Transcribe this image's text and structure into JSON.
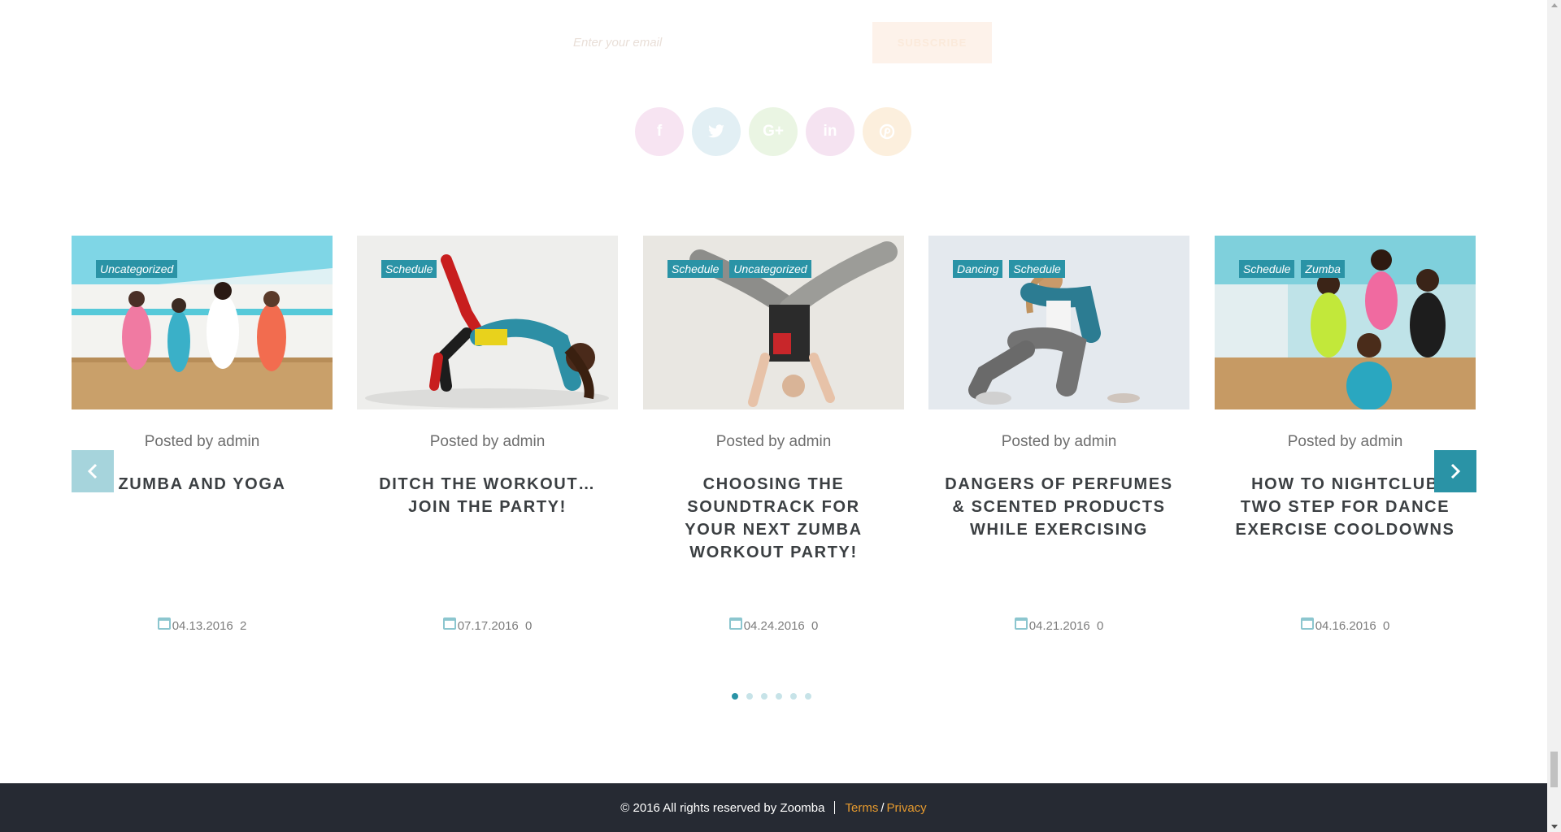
{
  "subscribe": {
    "email_placeholder": "Enter your email",
    "button_label": "SUBSCRIBE"
  },
  "social": [
    {
      "name": "facebook",
      "glyph": "f",
      "color": "#f7e4f2"
    },
    {
      "name": "twitter",
      "glyph": "t",
      "color": "#e2eff4"
    },
    {
      "name": "google-plus",
      "glyph": "G+",
      "color": "#eaf5e3"
    },
    {
      "name": "linkedin",
      "glyph": "in",
      "color": "#f5e3f1"
    },
    {
      "name": "pinterest",
      "glyph": "p",
      "color": "#fcefdd"
    }
  ],
  "slider": {
    "prev_label": "‹",
    "next_label": "›",
    "posts": [
      {
        "categories": [
          "Uncategorized"
        ],
        "posted_by": "Posted by admin",
        "title": "ZUMBA AND YOGA",
        "date": "04.13.2016",
        "comments": "2"
      },
      {
        "categories": [
          "Schedule"
        ],
        "posted_by": "Posted by admin",
        "title": "DITCH THE WORKOUT… JOIN THE PARTY!",
        "date": "07.17.2016",
        "comments": "0"
      },
      {
        "categories": [
          "Schedule",
          "Uncategorized"
        ],
        "posted_by": "Posted by admin",
        "title": "CHOOSING THE SOUNDTRACK FOR YOUR NEXT ZUMBA WORKOUT PARTY!",
        "date": "04.24.2016",
        "comments": "0"
      },
      {
        "categories": [
          "Dancing",
          "Schedule"
        ],
        "posted_by": "Posted by admin",
        "title": "DANGERS OF PERFUMES & SCENTED PRODUCTS WHILE EXERCISING",
        "date": "04.21.2016",
        "comments": "0"
      },
      {
        "categories": [
          "Schedule",
          "Zumba"
        ],
        "posted_by": "Posted by admin",
        "title": "HOW TO NIGHTCLUB TWO STEP FOR DANCE EXERCISE COOLDOWNS",
        "date": "04.16.2016",
        "comments": "0"
      }
    ],
    "dots_count": 6,
    "active_dot": 1
  },
  "footer": {
    "copyright": "© 2016 All rights reserved by Zoomba",
    "terms": "Terms",
    "separator": "/",
    "privacy": "Privacy"
  }
}
